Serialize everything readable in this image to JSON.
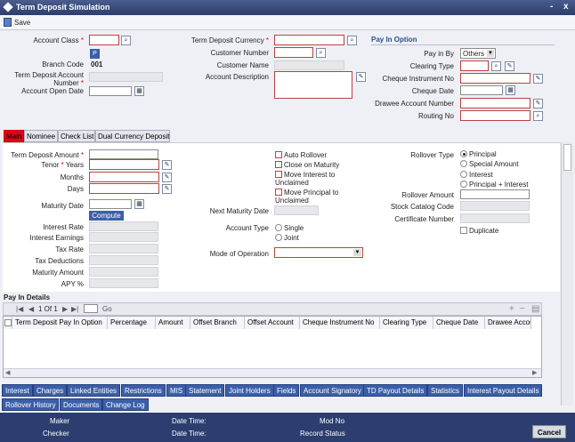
{
  "window": {
    "title": "Term Deposit Simulation",
    "controls": [
      "-",
      "x"
    ]
  },
  "toolbar": {
    "save": "Save"
  },
  "header": {
    "account_class": "Account Class",
    "branch_code": "Branch Code",
    "branch_code_value": "001",
    "td_account_number": "Term Deposit Account Number",
    "account_open_date": "Account Open Date",
    "p_label": "P",
    "td_currency": "Term Deposit Currency",
    "customer_number": "Customer Number",
    "customer_name": "Customer Name",
    "account_description": "Account Description"
  },
  "payin": {
    "section": "Pay In Option",
    "pay_in_by": "Pay in By",
    "pay_in_by_value": "Others",
    "clearing_type": "Clearing Type",
    "cheque_instrument_no": "Cheque Instrument No",
    "cheque_date": "Cheque Date",
    "drawee_account_number": "Drawee Account Number",
    "routing_no": "Routing No"
  },
  "tabs": [
    "Main",
    "Nominee",
    "Check List",
    "Dual Currency Deposit"
  ],
  "main": {
    "td_amount": "Term Deposit Amount",
    "tenor_years": "Years",
    "tenor": "Tenor",
    "months": "Months",
    "days": "Days",
    "maturity_date": "Maturity Date",
    "compute": "Compute",
    "interest_rate": "Interest Rate",
    "interest_earnings": "Interest Earnings",
    "tax_rate": "Tax Rate",
    "tax_deductions": "Tax Deductions",
    "maturity_amount": "Maturity Amount",
    "apy": "APY %",
    "auto_rollover": "Auto Rollover",
    "close_on_maturity": "Close on Maturity",
    "move_interest": "Move Interest to Unclaimed",
    "move_principal": "Move Principal to Unclaimed",
    "next_maturity_date": "Next Maturity Date",
    "account_type": "Account Type",
    "single": "Single",
    "joint": "Joint",
    "mode_of_operation": "Mode of Operation",
    "rollover_type": "Rollover Type",
    "rollover_options": [
      "Principal",
      "Special Amount",
      "Interest",
      "Principal + Interest"
    ],
    "rollover_amount": "Rollover Amount",
    "stock_catalog_code": "Stock Catalog Code",
    "certificate_number": "Certificate Number",
    "duplicate": "Duplicate"
  },
  "payin_details": {
    "title": "Pay In Details",
    "pager": "1 Of 1",
    "go": "Go",
    "columns": [
      "Term Deposit Pay In Option",
      "Percentage",
      "Amount",
      "Offset Branch",
      "Offset Account",
      "Cheque Instrument No",
      "Clearing Type",
      "Cheque Date",
      "Drawee Accou"
    ]
  },
  "subsystems": [
    "Interest",
    "Charges",
    "Linked Entities",
    "Restrictions",
    "MIS",
    "Statement",
    "Joint Holders",
    "Fields",
    "Account Signatory",
    "TD Payout Details",
    "Statistics",
    "Interest Payout Details",
    "Rollover History",
    "Documents",
    "Change Log"
  ],
  "footer": {
    "maker": "Maker",
    "checker": "Checker",
    "date_time_1": "Date Time:",
    "date_time_2": "Date Time:",
    "mod_no": "Mod No",
    "record_status": "Record Status",
    "cancel": "Cancel"
  }
}
